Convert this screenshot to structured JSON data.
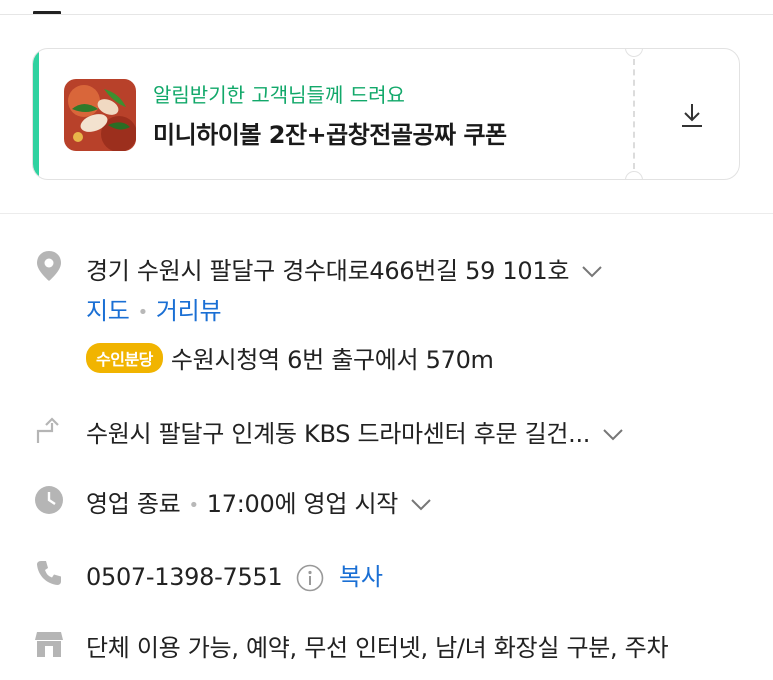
{
  "coupon": {
    "subtitle": "알림받기한 고객님들께 드려요",
    "title": "미니하이볼 2잔+곱창전골공짜 쿠폰"
  },
  "info": {
    "address": "경기 수원시 팔달구 경수대로466번길 59 101호",
    "map_link": "지도",
    "street_view_link": "거리뷰",
    "station_badge": "수인분당",
    "station_text": "수원시청역 6번 출구에서 570m",
    "directions": "수원시 팔달구 인계동 KBS 드라마센터 후문 길건...",
    "hours_status": "영업 종료",
    "hours_next": "17:00에 영업 시작",
    "phone": "0507-1398-7551",
    "copy_label": "복사",
    "amenities": "단체 이용 가능, 예약, 무선 인터넷, 남/녀 화장실 구분, 주차"
  },
  "colors": {
    "accent_green": "#2fd2a0",
    "subtitle_green": "#12a86a",
    "link_blue": "#1a6fd4",
    "badge_yellow": "#f1b400",
    "icon_gray": "#b5b5b5"
  },
  "icons": [
    "pin-icon",
    "directions-icon",
    "clock-icon",
    "phone-icon",
    "info-icon",
    "store-icon",
    "download-icon",
    "chevron-down-icon"
  ]
}
